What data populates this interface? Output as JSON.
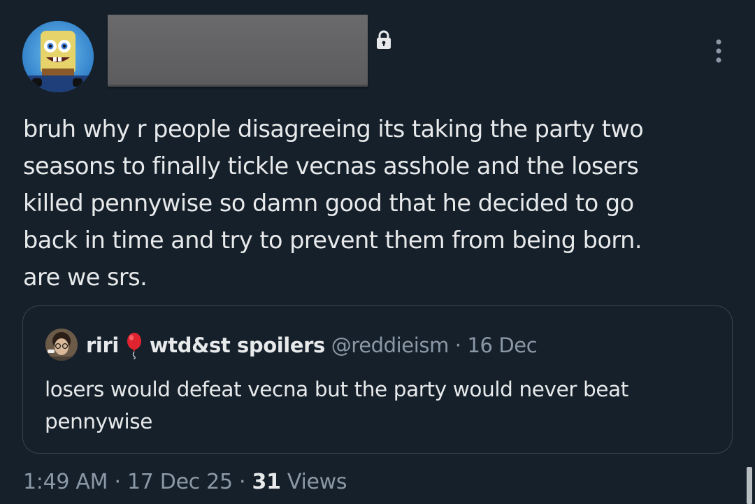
{
  "tweet": {
    "text": "bruh why r people disagreeing its taking the party two\nseasons to finally tickle vecnas asshole and the losers\nkilled pennywise so damn good that he decided to go\nback in time and try to prevent them from being born.\nare we srs."
  },
  "quoted_tweet": {
    "name_part1": "riri",
    "name_part2": "wtd&st spoilers",
    "handle": "@reddieism",
    "separator": "·",
    "date": "16 Dec",
    "text": "losers would defeat vecna but the party would never beat pennywise"
  },
  "meta": {
    "time": "1:49 AM",
    "sep1": "·",
    "date": "17 Dec 25",
    "sep2": "·",
    "views_count": "31",
    "views_label": "Views"
  },
  "colors": {
    "background": "#15202b",
    "text": "#e7e9ea",
    "secondary": "#8b98a5",
    "border": "#38444d"
  },
  "icons": [
    "avatar-spongebob",
    "lock-icon",
    "more-icon",
    "balloon-icon"
  ]
}
